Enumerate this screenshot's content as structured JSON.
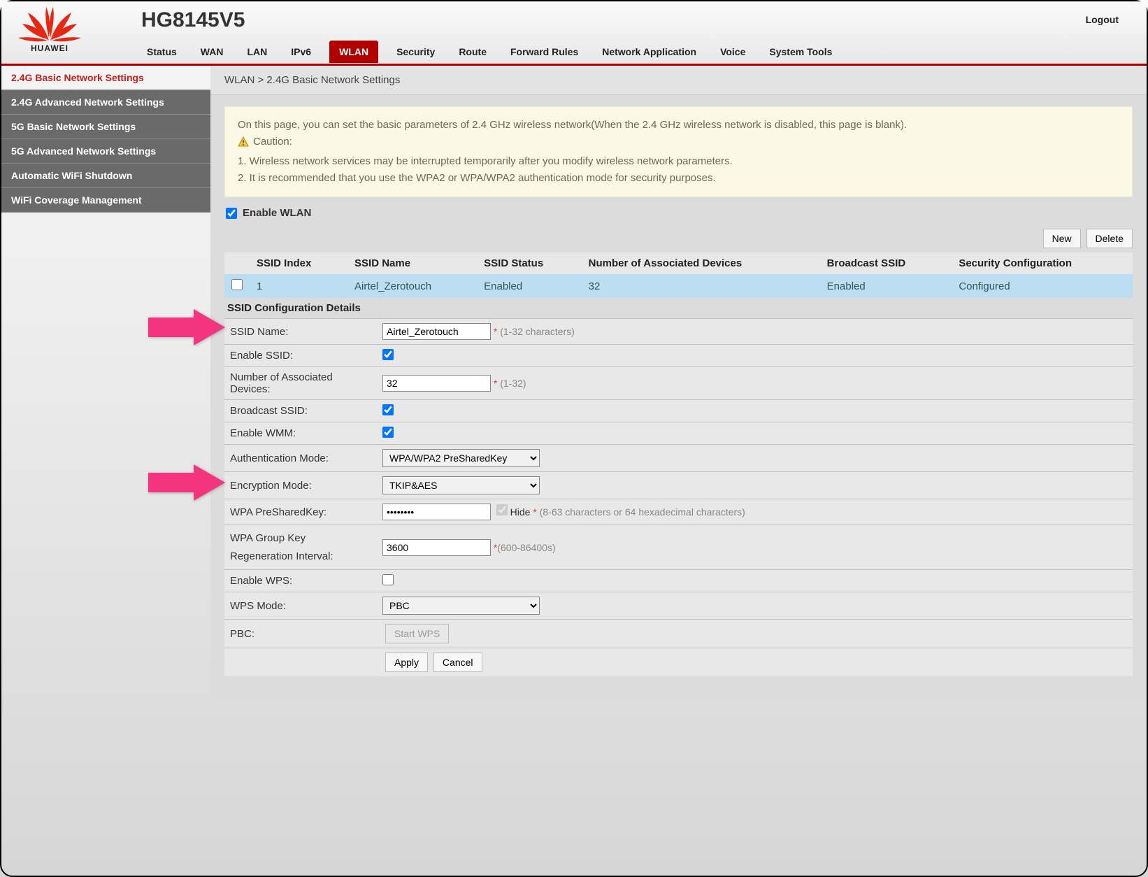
{
  "brand": "HUAWEI",
  "model": "HG8145V5",
  "logout": "Logout",
  "tabs": [
    "Status",
    "WAN",
    "LAN",
    "IPv6",
    "WLAN",
    "Security",
    "Route",
    "Forward Rules",
    "Network Application",
    "Voice",
    "System Tools"
  ],
  "active_tab": "WLAN",
  "sidebar": {
    "items": [
      "2.4G Basic Network Settings",
      "2.4G Advanced Network Settings",
      "5G Basic Network Settings",
      "5G Advanced Network Settings",
      "Automatic WiFi Shutdown",
      "WiFi Coverage Management"
    ],
    "active_index": 0
  },
  "breadcrumb": "WLAN > 2.4G Basic Network Settings",
  "notice": {
    "p1": "On this page, you can set the basic parameters of 2.4 GHz wireless network(When the 2.4 GHz wireless network is disabled, this page is blank).",
    "caution_label": "Caution:",
    "l1": "1. Wireless network services may be interrupted temporarily after you modify wireless network parameters.",
    "l2": "2. It is recommended that you use the WPA2 or WPA/WPA2 authentication mode for security purposes."
  },
  "enable_wlan_label": "Enable WLAN",
  "enable_wlan_checked": true,
  "buttons": {
    "new": "New",
    "delete": "Delete",
    "apply": "Apply",
    "cancel": "Cancel",
    "start_wps": "Start WPS"
  },
  "table": {
    "headers": [
      "SSID Index",
      "SSID Name",
      "SSID Status",
      "Number of Associated Devices",
      "Broadcast SSID",
      "Security Configuration"
    ],
    "row": {
      "index": "1",
      "name": "Airtel_Zerotouch",
      "status": "Enabled",
      "devices": "32",
      "broadcast": "Enabled",
      "security": "Configured"
    }
  },
  "section_title": "SSID Configuration Details",
  "form": {
    "ssid_name": {
      "label": "SSID Name:",
      "value": "Airtel_Zerotouch",
      "hint": "(1-32 characters)"
    },
    "enable_ssid": {
      "label": "Enable SSID:",
      "checked": true
    },
    "assoc_devices": {
      "label": "Number of Associated Devices:",
      "value": "32",
      "hint": "(1-32)"
    },
    "broadcast": {
      "label": "Broadcast SSID:",
      "checked": true
    },
    "wmm": {
      "label": "Enable WMM:",
      "checked": true
    },
    "auth_mode": {
      "label": "Authentication Mode:",
      "value": "WPA/WPA2 PreSharedKey"
    },
    "enc_mode": {
      "label": "Encryption Mode:",
      "value": "TKIP&AES"
    },
    "psk": {
      "label": "WPA PreSharedKey:",
      "value": "••••••••",
      "hide_label": "Hide",
      "hint": "(8-63 characters or 64 hexadecimal characters)"
    },
    "group_key": {
      "label": "WPA Group Key Regeneration Interval:",
      "value": "3600",
      "hint": "(600-86400s)"
    },
    "wps": {
      "label": "Enable WPS:",
      "checked": false
    },
    "wps_mode": {
      "label": "WPS Mode:",
      "value": "PBC"
    },
    "pbc": {
      "label": "PBC:"
    }
  }
}
